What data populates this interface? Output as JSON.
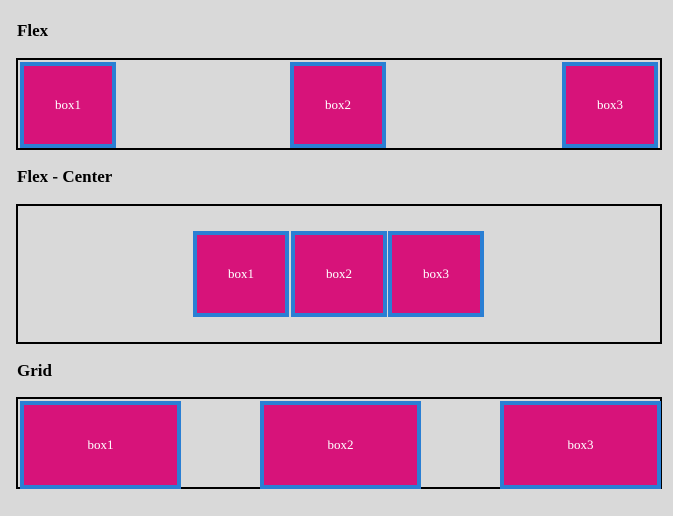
{
  "colors": {
    "background": "#d9d9d9",
    "box_fill": "#d7137a",
    "box_border": "#2a7fd4",
    "container_border": "#000000",
    "box_text": "#ffffff"
  },
  "sections": [
    {
      "heading": "Flex",
      "boxes": [
        "box1",
        "box2",
        "box3"
      ]
    },
    {
      "heading": "Flex - Center",
      "boxes": [
        "box1",
        "box2",
        "box3"
      ]
    },
    {
      "heading": "Grid",
      "boxes": [
        "box1",
        "box2",
        "box3"
      ]
    }
  ]
}
